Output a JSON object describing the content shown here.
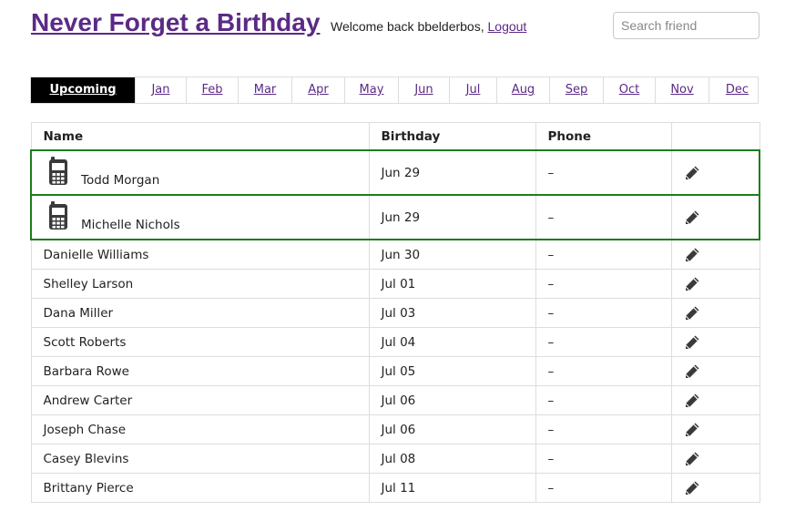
{
  "header": {
    "title": "Never Forget a Birthday",
    "welcome_text": "Welcome back bbelderbos, ",
    "logout_label": "Logout",
    "search_placeholder": "Search friend"
  },
  "tabs": [
    {
      "label": "Upcoming",
      "active": true
    },
    {
      "label": "Jan"
    },
    {
      "label": "Feb"
    },
    {
      "label": "Mar"
    },
    {
      "label": "Apr"
    },
    {
      "label": "May"
    },
    {
      "label": "Jun"
    },
    {
      "label": "Jul"
    },
    {
      "label": "Aug"
    },
    {
      "label": "Sep"
    },
    {
      "label": "Oct"
    },
    {
      "label": "Nov"
    },
    {
      "label": "Dec"
    }
  ],
  "table": {
    "columns": [
      "Name",
      "Birthday",
      "Phone",
      ""
    ],
    "rows": [
      {
        "name": "Todd Morgan",
        "birthday": "Jun 29",
        "phone": "–",
        "highlight": true,
        "icon": "mobile-phone-icon"
      },
      {
        "name": "Michelle Nichols",
        "birthday": "Jun 29",
        "phone": "–",
        "highlight": true,
        "icon": "mobile-phone-icon"
      },
      {
        "name": "Danielle Williams",
        "birthday": "Jun 30",
        "phone": "–"
      },
      {
        "name": "Shelley Larson",
        "birthday": "Jul 01",
        "phone": "–"
      },
      {
        "name": "Dana Miller",
        "birthday": "Jul 03",
        "phone": "–"
      },
      {
        "name": "Scott Roberts",
        "birthday": "Jul 04",
        "phone": "–"
      },
      {
        "name": "Barbara Rowe",
        "birthday": "Jul 05",
        "phone": "–"
      },
      {
        "name": "Andrew Carter",
        "birthday": "Jul 06",
        "phone": "–"
      },
      {
        "name": "Joseph Chase",
        "birthday": "Jul 06",
        "phone": "–"
      },
      {
        "name": "Casey Blevins",
        "birthday": "Jul 08",
        "phone": "–"
      },
      {
        "name": "Brittany Pierce",
        "birthday": "Jul 11",
        "phone": "–"
      }
    ],
    "edit_icon": "pencil-icon"
  },
  "colors": {
    "title": "#5b2a86",
    "active_tab": "#000000",
    "today_highlight": "#1e7d1e"
  }
}
